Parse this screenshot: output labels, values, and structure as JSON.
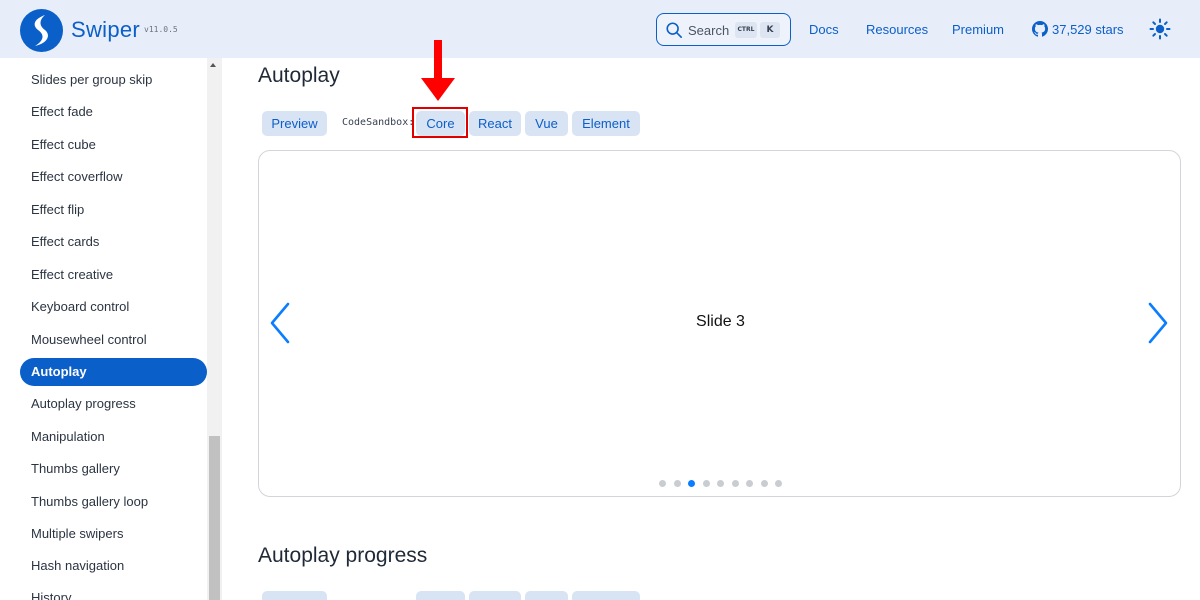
{
  "header": {
    "brand": "Swiper",
    "version": "v11.0.5",
    "search": {
      "label": "Search",
      "kbd_ctrl": "CTRL",
      "kbd_k": "K"
    },
    "nav": [
      "Docs",
      "Resources",
      "Premium"
    ],
    "github_stars": "37,529 stars"
  },
  "sidebar": {
    "items": [
      "Slides per group skip",
      "Effect fade",
      "Effect cube",
      "Effect coverflow",
      "Effect flip",
      "Effect cards",
      "Effect creative",
      "Keyboard control",
      "Mousewheel control",
      "Autoplay",
      "Autoplay progress",
      "Manipulation",
      "Thumbs gallery",
      "Thumbs gallery loop",
      "Multiple swipers",
      "Hash navigation",
      "History"
    ],
    "active": "Autoplay"
  },
  "main": {
    "section1": {
      "title": "Autoplay",
      "preview_label": "Preview",
      "codesandbox_label": "CodeSandbox:",
      "tabs": [
        "Core",
        "React",
        "Vue",
        "Element"
      ],
      "slide_text": "Slide 3",
      "pagination_count": 9,
      "pagination_active_index": 2
    },
    "section2": {
      "title": "Autoplay progress"
    }
  },
  "colors": {
    "accent": "#0b5fc9",
    "header_bg": "#e8eef9",
    "button_bg": "#d8e3f4",
    "annotation_red": "#ff0000"
  },
  "icons": [
    "swiper-logo-icon",
    "search-icon",
    "github-icon",
    "sun-icon",
    "chevron-left-icon",
    "chevron-right-icon",
    "red-arrow-down-annotation"
  ]
}
